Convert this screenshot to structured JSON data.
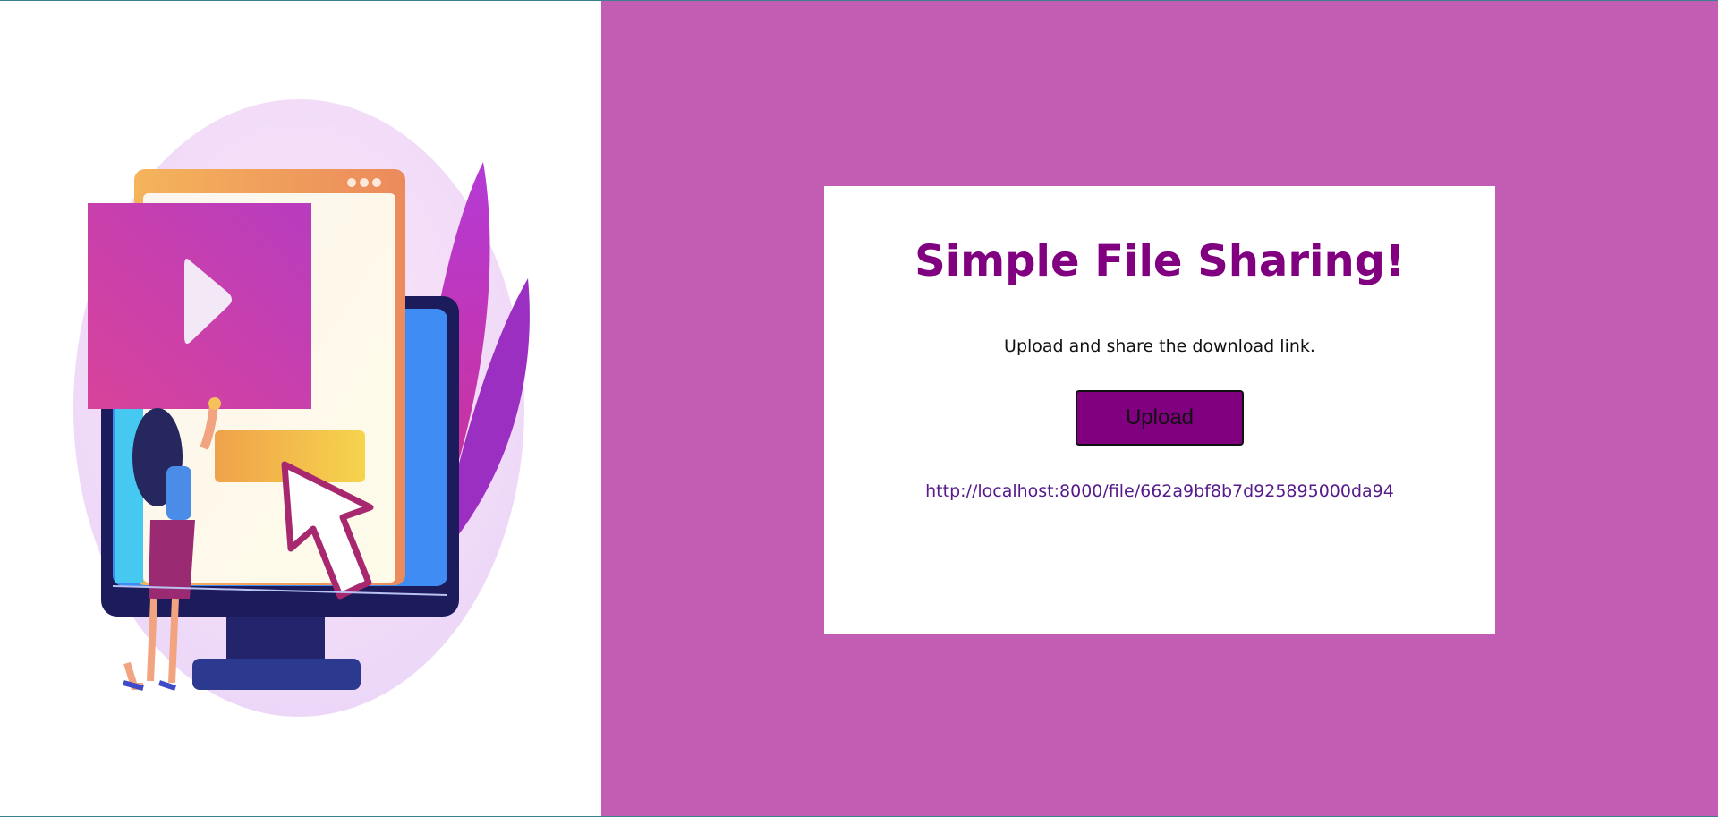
{
  "illustration": {
    "icon": "file-sharing-illustration",
    "play_icon": "play-icon",
    "cursor_icon": "cursor-arrow-icon"
  },
  "card": {
    "title": "Simple File Sharing!",
    "subtitle": "Upload and share the download link.",
    "upload_label": "Upload",
    "download_link": "http://localhost:8000/file/662a9bf8b7d925895000da94"
  },
  "colors": {
    "accent": "#800080",
    "background": "#c25db3",
    "card": "#ffffff"
  }
}
